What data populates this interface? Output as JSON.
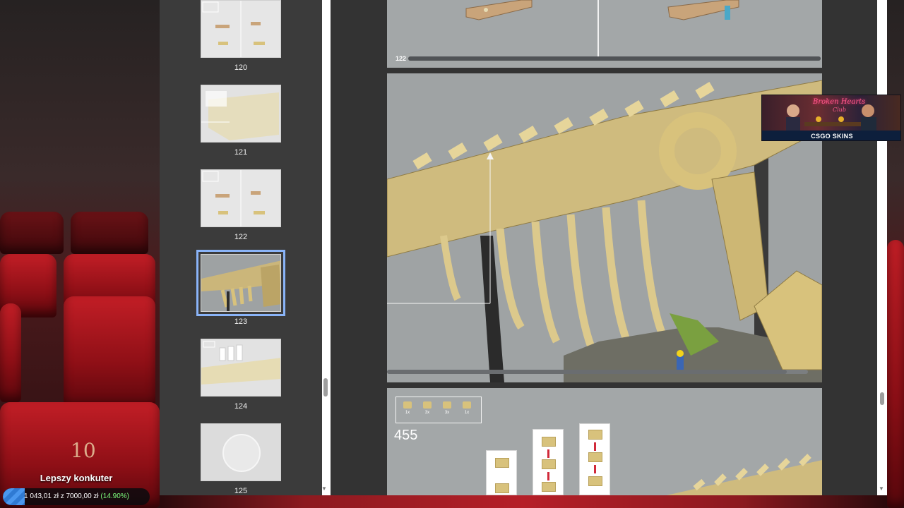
{
  "thumbnails": [
    {
      "page": "120"
    },
    {
      "page": "121"
    },
    {
      "page": "122"
    },
    {
      "page": "123",
      "selected": true
    },
    {
      "page": "124"
    },
    {
      "page": "125"
    }
  ],
  "pages": {
    "top_page_number": "122",
    "top_progress_fraction": 1.0,
    "middle_progress_fraction": 0.95,
    "step_number": "455",
    "parts": [
      {
        "qty": "1x"
      },
      {
        "qty": "3x"
      },
      {
        "qty": "3x"
      },
      {
        "qty": "1x"
      }
    ]
  },
  "ad": {
    "title": "Broken Hearts",
    "subtitle": "Club",
    "brand": "CSGO SKINS"
  },
  "background": {
    "seat_number": "10"
  },
  "donation_goal": {
    "title": "Lepszy konkuter",
    "amount_text": "1 043,01 zł z 7000,00 zł",
    "percent_text": "(14.90%)",
    "progress_fraction": 0.149
  },
  "colors": {
    "thumb_selected": "#8ab4f8",
    "goal_fill": "#2f7ad3",
    "goal_percent": "#7cfc7c"
  }
}
